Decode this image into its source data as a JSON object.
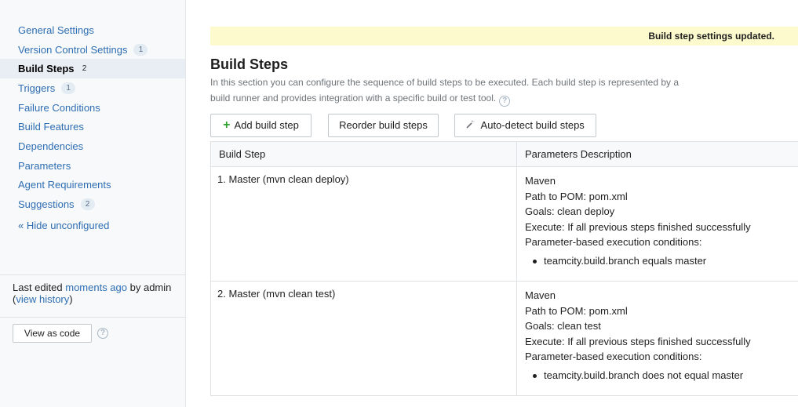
{
  "sidebar": {
    "nav": [
      {
        "label": "General Settings",
        "badge": ""
      },
      {
        "label": "Version Control Settings",
        "badge": "1"
      },
      {
        "label": "Build Steps",
        "badge": "2"
      },
      {
        "label": "Triggers",
        "badge": "1"
      },
      {
        "label": "Failure Conditions",
        "badge": ""
      },
      {
        "label": "Build Features",
        "badge": ""
      },
      {
        "label": "Dependencies",
        "badge": ""
      },
      {
        "label": "Parameters",
        "badge": ""
      },
      {
        "label": "Agent Requirements",
        "badge": ""
      },
      {
        "label": "Suggestions",
        "badge": "2"
      }
    ],
    "hide_unconfigured": "« Hide unconfigured",
    "last_edited_prefix": "Last edited",
    "last_edited_when": "moments ago",
    "last_edited_by": "by admin",
    "view_history_open": "(",
    "view_history": "view history",
    "view_history_close": ")",
    "view_as_code": "View as code",
    "help_glyph": "?"
  },
  "banner": {
    "text": "Build step settings updated."
  },
  "main": {
    "title": "Build Steps",
    "description": "In this section you can configure the sequence of build steps to be executed. Each build step is represented by a build runner and provides integration with a specific build or test tool.",
    "help_glyph": "?",
    "buttons": {
      "add_icon": "+",
      "add": "Add build step",
      "reorder": "Reorder build steps",
      "auto_detect_icon": "wand-icon",
      "auto_detect": "Auto-detect build steps"
    }
  },
  "table": {
    "headers": {
      "step": "Build Step",
      "params": "Parameters Description"
    },
    "rows": [
      {
        "name": "1. Master (mvn clean deploy)",
        "runner": "Maven",
        "pom": "Path to POM: pom.xml",
        "goals": "Goals: clean deploy",
        "execute": "Execute: If all previous steps finished successfully",
        "conditions_label": "Parameter-based execution conditions:",
        "condition": "teamcity.build.branch equals master"
      },
      {
        "name": "2. Master (mvn clean test)",
        "runner": "Maven",
        "pom": "Path to POM: pom.xml",
        "goals": "Goals: clean test",
        "execute": "Execute: If all previous steps finished successfully",
        "conditions_label": "Parameter-based execution conditions:",
        "condition": "teamcity.build.branch does not equal master"
      }
    ]
  },
  "colors": {
    "link": "#2f6eb3",
    "banner_bg": "#fdfbcd",
    "active_nav_bg": "#e8eef4",
    "add_icon": "#2fa32f"
  }
}
